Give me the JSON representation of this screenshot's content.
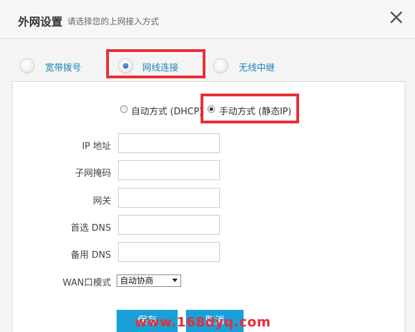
{
  "header": {
    "title": "外网设置",
    "subtitle": "请选择您的上网接入方式",
    "close_icon": "close-icon"
  },
  "connection_modes": {
    "selected": "网线连接",
    "items": [
      {
        "label": "宽带拨号",
        "selected": false
      },
      {
        "label": "网线连接",
        "selected": true
      },
      {
        "label": "无线中继",
        "selected": false
      }
    ]
  },
  "ip_modes": {
    "selected": "手动方式 (静态IP)",
    "auto_label": "自动方式 (DHCP)",
    "manual_label": "手动方式 (静态IP)"
  },
  "form": {
    "ip_label": "IP 地址",
    "ip_value": "",
    "subnet_label": "子网掩码",
    "subnet_value": "",
    "gateway_label": "网关",
    "gateway_value": "",
    "primary_dns_label": "首选 DNS",
    "primary_dns_value": "",
    "backup_dns_label": "备用 DNS",
    "backup_dns_value": "",
    "wan_mode_label": "WAN口模式",
    "wan_mode_value": "自动协商"
  },
  "buttons": {
    "save_label": "保存",
    "cancel_label": "取消"
  },
  "watermark": "www.168dyq.com",
  "colors": {
    "accent": "#1aa0d8",
    "link_text": "#1d84b8",
    "highlight": "#e82d35"
  }
}
